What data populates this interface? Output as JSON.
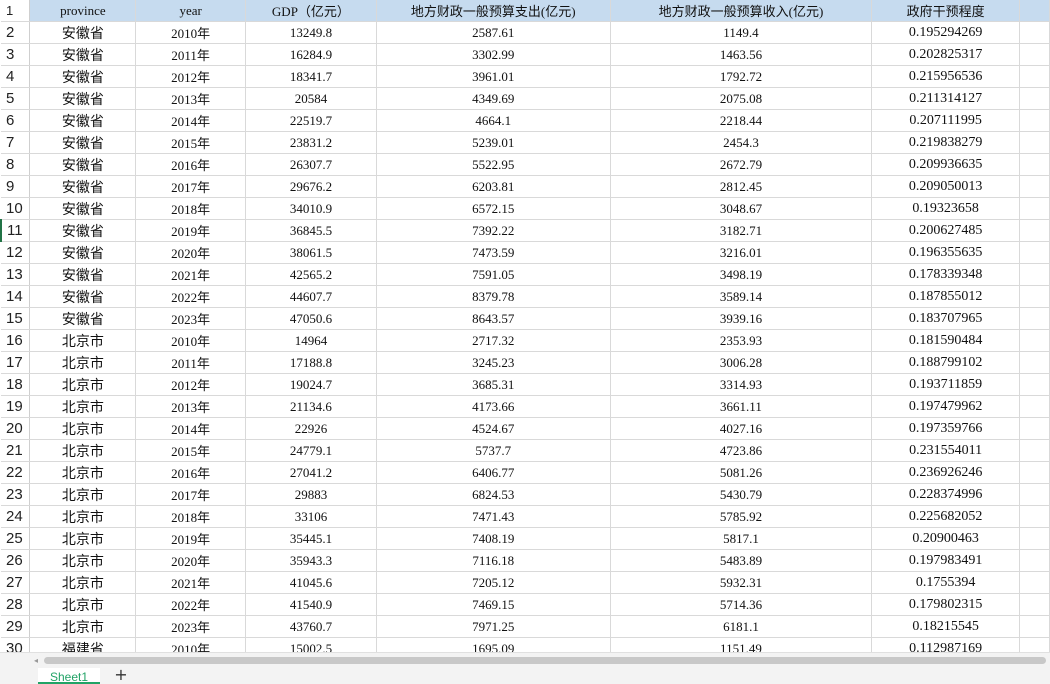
{
  "headers": [
    "province",
    "year",
    "GDP（亿元）",
    "地方财政一般预算支出(亿元)",
    "地方财政一般预算收入(亿元)",
    "政府干预程度"
  ],
  "rows": [
    [
      "安徽省",
      "2010年",
      "13249.8",
      "2587.61",
      "1149.4",
      "0.195294269"
    ],
    [
      "安徽省",
      "2011年",
      "16284.9",
      "3302.99",
      "1463.56",
      "0.202825317"
    ],
    [
      "安徽省",
      "2012年",
      "18341.7",
      "3961.01",
      "1792.72",
      "0.215956536"
    ],
    [
      "安徽省",
      "2013年",
      "20584",
      "4349.69",
      "2075.08",
      "0.211314127"
    ],
    [
      "安徽省",
      "2014年",
      "22519.7",
      "4664.1",
      "2218.44",
      "0.207111995"
    ],
    [
      "安徽省",
      "2015年",
      "23831.2",
      "5239.01",
      "2454.3",
      "0.219838279"
    ],
    [
      "安徽省",
      "2016年",
      "26307.7",
      "5522.95",
      "2672.79",
      "0.209936635"
    ],
    [
      "安徽省",
      "2017年",
      "29676.2",
      "6203.81",
      "2812.45",
      "0.209050013"
    ],
    [
      "安徽省",
      "2018年",
      "34010.9",
      "6572.15",
      "3048.67",
      "0.19323658"
    ],
    [
      "安徽省",
      "2019年",
      "36845.5",
      "7392.22",
      "3182.71",
      "0.200627485"
    ],
    [
      "安徽省",
      "2020年",
      "38061.5",
      "7473.59",
      "3216.01",
      "0.196355635"
    ],
    [
      "安徽省",
      "2021年",
      "42565.2",
      "7591.05",
      "3498.19",
      "0.178339348"
    ],
    [
      "安徽省",
      "2022年",
      "44607.7",
      "8379.78",
      "3589.14",
      "0.187855012"
    ],
    [
      "安徽省",
      "2023年",
      "47050.6",
      "8643.57",
      "3939.16",
      "0.183707965"
    ],
    [
      "北京市",
      "2010年",
      "14964",
      "2717.32",
      "2353.93",
      "0.181590484"
    ],
    [
      "北京市",
      "2011年",
      "17188.8",
      "3245.23",
      "3006.28",
      "0.188799102"
    ],
    [
      "北京市",
      "2012年",
      "19024.7",
      "3685.31",
      "3314.93",
      "0.193711859"
    ],
    [
      "北京市",
      "2013年",
      "21134.6",
      "4173.66",
      "3661.11",
      "0.197479962"
    ],
    [
      "北京市",
      "2014年",
      "22926",
      "4524.67",
      "4027.16",
      "0.197359766"
    ],
    [
      "北京市",
      "2015年",
      "24779.1",
      "5737.7",
      "4723.86",
      "0.231554011"
    ],
    [
      "北京市",
      "2016年",
      "27041.2",
      "6406.77",
      "5081.26",
      "0.236926246"
    ],
    [
      "北京市",
      "2017年",
      "29883",
      "6824.53",
      "5430.79",
      "0.228374996"
    ],
    [
      "北京市",
      "2018年",
      "33106",
      "7471.43",
      "5785.92",
      "0.225682052"
    ],
    [
      "北京市",
      "2019年",
      "35445.1",
      "7408.19",
      "5817.1",
      "0.20900463"
    ],
    [
      "北京市",
      "2020年",
      "35943.3",
      "7116.18",
      "5483.89",
      "0.197983491"
    ],
    [
      "北京市",
      "2021年",
      "41045.6",
      "7205.12",
      "5932.31",
      "0.1755394"
    ],
    [
      "北京市",
      "2022年",
      "41540.9",
      "7469.15",
      "5714.36",
      "0.179802315"
    ],
    [
      "北京市",
      "2023年",
      "43760.7",
      "7971.25",
      "6181.1",
      "0.18215545"
    ],
    [
      "福建省",
      "2010年",
      "15002.5",
      "1695.09",
      "1151.49",
      "0.112987169"
    ]
  ],
  "row_numbers": [
    "1",
    "2",
    "3",
    "4",
    "5",
    "6",
    "7",
    "8",
    "9",
    "10",
    "11",
    "12",
    "13",
    "14",
    "15",
    "16",
    "17",
    "18",
    "19",
    "20",
    "21",
    "22",
    "23",
    "24",
    "25",
    "26",
    "27",
    "28",
    "29",
    "30"
  ],
  "selected_row_number": "11",
  "sheet_tab": {
    "label": "Sheet1",
    "add_label": "+"
  },
  "scrollbar": {
    "left_arrow": "◂"
  },
  "colors": {
    "header_fill": "#c6dbef",
    "gridline": "#d9d9d9",
    "active_tab": "#21a366",
    "selection": "#217346"
  }
}
